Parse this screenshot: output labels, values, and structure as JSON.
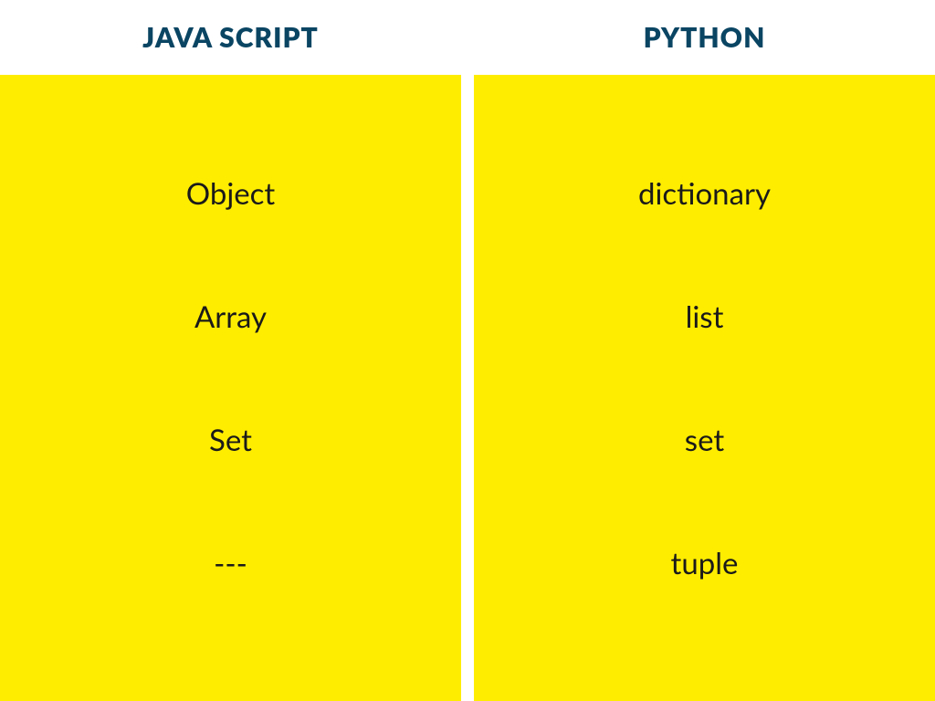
{
  "columns": [
    {
      "header": "JAVA SCRIPT",
      "items": [
        "Object",
        "Array",
        "Set",
        "---"
      ]
    },
    {
      "header": "PYTHON",
      "items": [
        "dictionary",
        "list",
        "set",
        "tuple"
      ]
    }
  ]
}
